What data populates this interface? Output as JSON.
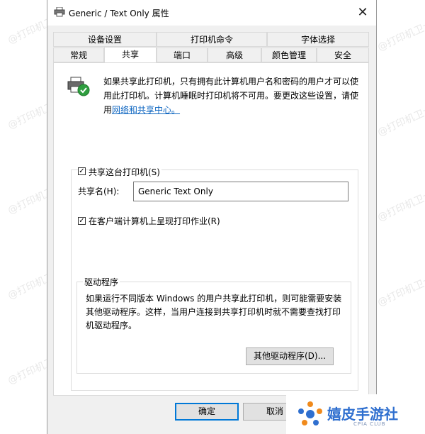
{
  "window": {
    "title": "Generic / Text Only 属性",
    "close_symbol": "✕"
  },
  "tabs_top": [
    "设备设置",
    "打印机命令",
    "字体选择"
  ],
  "tabs_bottom": [
    "常规",
    "共享",
    "端口",
    "高级",
    "颜色管理",
    "安全"
  ],
  "active_tab": "共享",
  "sharing": {
    "desc_line1": "如果共享此打印机，只有拥有此计算机用户名和密码的用户才可以使用此打印机。计算机睡眠时打印机将不可用。要更改这些设置，请使",
    "desc_line2_prefix": "用",
    "link": "网络和共享中心。",
    "share_checkbox_label": "共享这台打印机(S)",
    "share_checked": true,
    "share_name_label": "共享名(H):",
    "share_name_value": "Generic  Text Only",
    "render_checkbox_label": "在客户端计算机上呈现打印作业(R)",
    "render_checked": true
  },
  "drivers": {
    "group_title": "驱动程序",
    "desc": "如果运行不同版本 Windows 的用户共享此打印机，则可能需要安装其他驱动程序。这样，当用户连接到共享打印机时就不需要查找打印机驱动程序。",
    "button": "其他驱动程序(D)..."
  },
  "buttons": {
    "ok": "确定",
    "cancel": "取消"
  },
  "watermark": "@打印机卫士",
  "logo": {
    "name": "嬉皮手游社",
    "sub": "CPIA CLUB"
  },
  "colors": {
    "link": "#0b64c0",
    "focus_border": "#0078d7",
    "logo_blue": "#2f6fcf",
    "logo_orange": "#f08a1c"
  }
}
